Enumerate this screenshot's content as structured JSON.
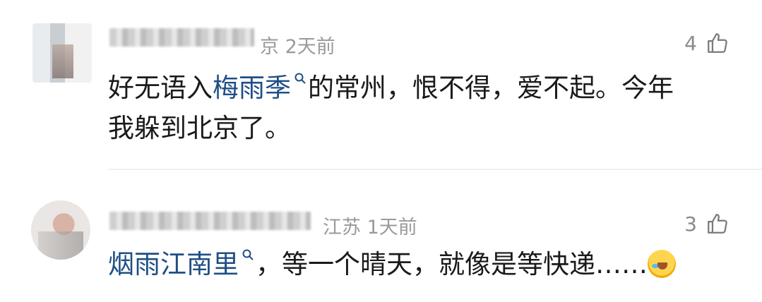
{
  "comments": [
    {
      "meta": "京 2天前",
      "likes": "4",
      "text_before": "好无语入",
      "tag": "梅雨季",
      "text_after_line1": "的常州，恨不得，爱不起。今年",
      "text_line2": "我躲到北京了。"
    },
    {
      "meta": "江苏 1天前",
      "likes": "3",
      "tag": "烟雨江南里",
      "text_after": "，等一个晴天，就像是等快递……"
    }
  ],
  "icons": {
    "like": "thumbs-up-icon",
    "search": "search-icon",
    "emoji": "laughing-crying-emoji-icon"
  },
  "colors": {
    "tag": "#1f4e86",
    "meta": "#9a9a9a",
    "text": "#1a1a1a"
  }
}
